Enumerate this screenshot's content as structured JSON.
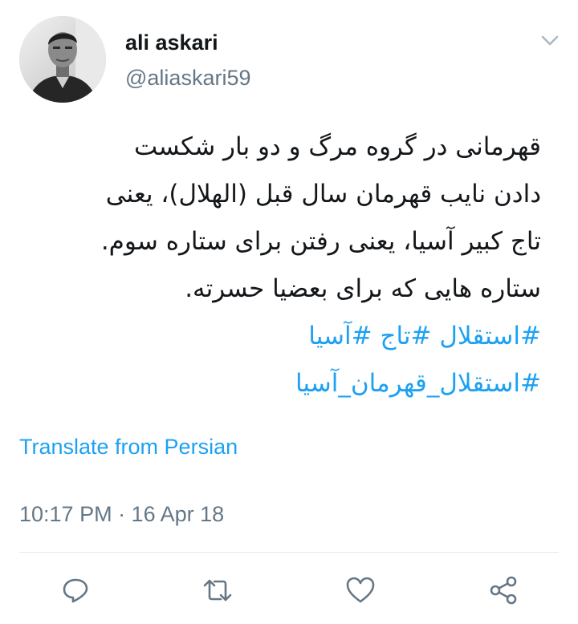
{
  "user": {
    "display_name": "ali askari",
    "handle": "@aliaskari59"
  },
  "tweet": {
    "lines": [
      "قهرمانی در گروه مرگ و دو بار شکست",
      "دادن نایب قهرمان سال قبل (الهلال)، یعنی",
      "تاج کبیر آسیا، یعنی رفتن برای ستاره سوم.",
      "ستاره هایی که برای بعضیا حسرته."
    ],
    "hashtags": [
      "#استقلال #تاج #آسیا",
      "#استقلال_قهرمان_آسیا"
    ]
  },
  "translate_label": "Translate from Persian",
  "timestamp": "10:17 PM · 16 Apr 18",
  "colors": {
    "link": "#1da1f2",
    "secondary_text": "#657786",
    "icon": "#657786",
    "divider": "#e1e8ed"
  },
  "actions": {
    "reply": "reply-icon",
    "retweet": "retweet-icon",
    "like": "heart-icon",
    "share": "share-icon"
  }
}
